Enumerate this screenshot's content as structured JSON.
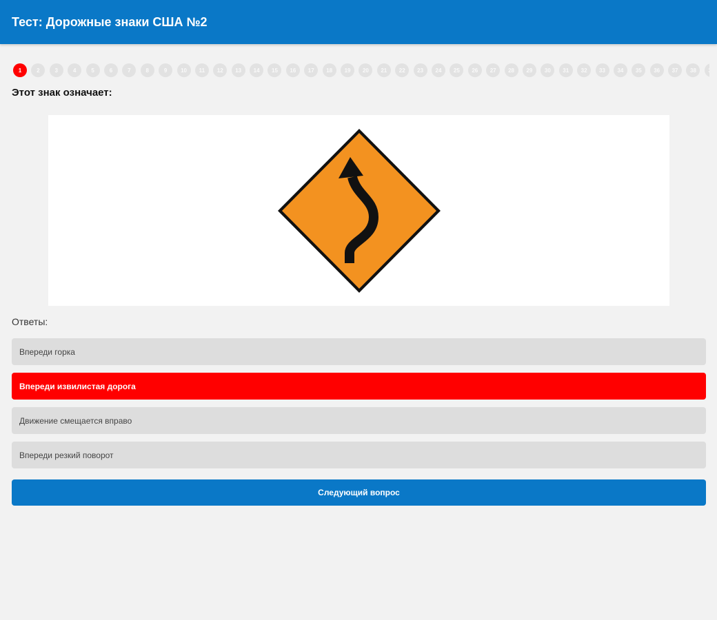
{
  "header": {
    "title": "Тест: Дорожные знаки США №2"
  },
  "progress": {
    "current": 1,
    "items": [
      "1",
      "2",
      "3",
      "4",
      "5",
      "6",
      "7",
      "8",
      "9",
      "10",
      "11",
      "12",
      "13",
      "14",
      "15",
      "16",
      "17",
      "18",
      "19",
      "20",
      "21",
      "22",
      "23",
      "24",
      "25",
      "26",
      "27",
      "28",
      "29",
      "30",
      "31",
      "32",
      "33",
      "34",
      "35",
      "36",
      "37",
      "38",
      "39"
    ]
  },
  "question": {
    "text": "Этот знак означает:"
  },
  "sign": {
    "icon": "winding-road-sign",
    "color": "#f39220"
  },
  "answers": {
    "label": "Ответы:",
    "options": [
      {
        "text": "Впереди горка",
        "selected": false
      },
      {
        "text": "Впереди извилистая дорога",
        "selected": true
      },
      {
        "text": "Движение смещается вправо",
        "selected": false
      },
      {
        "text": "Впереди резкий поворот",
        "selected": false
      }
    ]
  },
  "next_button": {
    "label": "Следующий вопрос"
  },
  "colors": {
    "accent": "#0a78c7",
    "selected": "#ff0000"
  }
}
